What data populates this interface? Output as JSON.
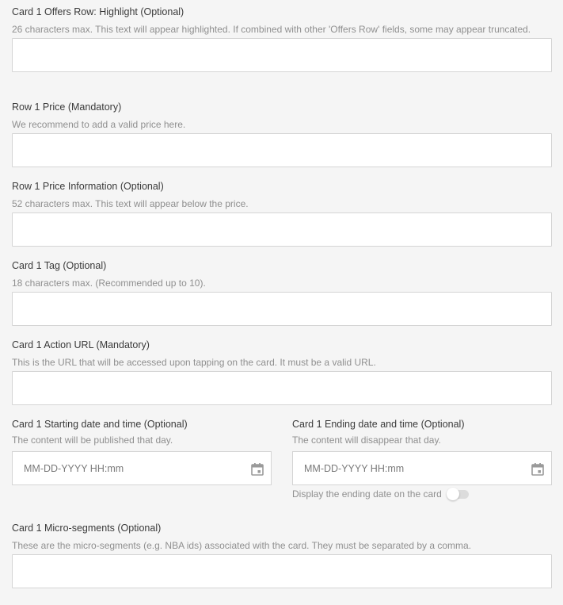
{
  "fields": {
    "offers_highlight": {
      "label": "Card 1 Offers Row: Highlight (Optional)",
      "help": "26 characters max. This text will appear highlighted. If combined with other 'Offers Row' fields, some may appear truncated.",
      "value": ""
    },
    "row_price": {
      "label": "Row 1 Price (Mandatory)",
      "help": "We recommend to add a valid price here.",
      "value": ""
    },
    "row_price_info": {
      "label": "Row 1 Price Information (Optional)",
      "help": "52 characters max. This text will appear below the price.",
      "value": ""
    },
    "tag": {
      "label": "Card 1 Tag (Optional)",
      "help": "18 characters max. (Recommended up to 10).",
      "value": ""
    },
    "action_url": {
      "label": "Card 1 Action URL (Mandatory)",
      "help": "This is the URL that will be accessed upon tapping on the card. It must be a valid URL.",
      "value": ""
    },
    "start_date": {
      "label": "Card 1 Starting date and time (Optional)",
      "help": "The content will be published that day.",
      "placeholder": "MM-DD-YYYY HH:mm",
      "icon": "calendar-icon"
    },
    "end_date": {
      "label": "Card 1 Ending date and time (Optional)",
      "help": "The content will disappear that day.",
      "placeholder": "MM-DD-YYYY HH:mm",
      "icon": "calendar-icon",
      "toggle_label": "Display the ending date on the card",
      "toggle_on": false
    },
    "micro_segments": {
      "label": "Card 1 Micro-segments (Optional)",
      "help": "These are the micro-segments (e.g. NBA ids) associated with the card. They must be separated by a comma.",
      "value": ""
    }
  },
  "colors": {
    "background": "#f5f5f5",
    "input_border": "#d5d5d5",
    "label_text": "#3a3a3a",
    "help_text": "#8f8f8f",
    "icon": "#9a9a9a"
  }
}
